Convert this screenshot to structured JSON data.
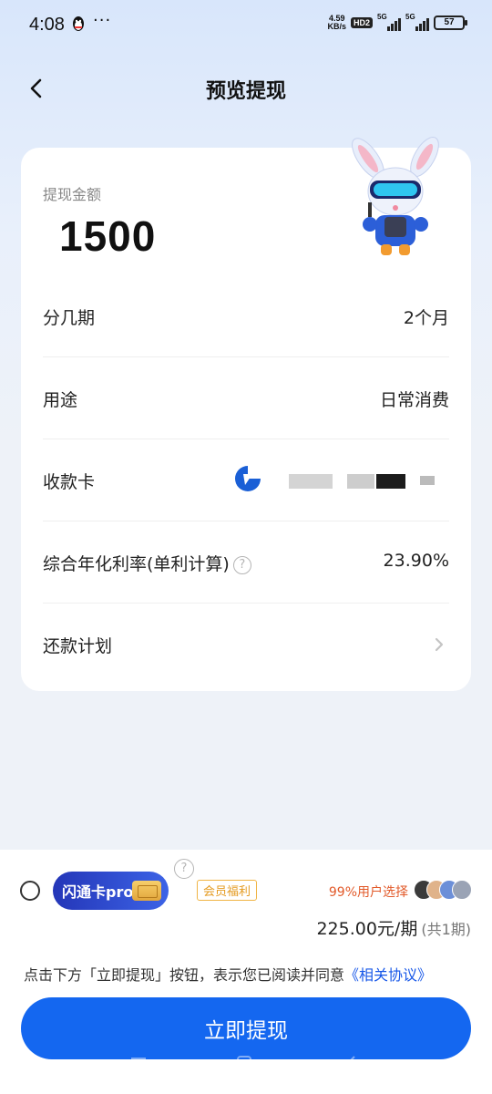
{
  "status_bar": {
    "time": "4:08",
    "dots": "···",
    "net_speed_value": "4.59",
    "net_speed_unit": "KB/s",
    "hd_badge": "HD2",
    "signal_1": "5G",
    "signal_2": "5G",
    "battery": "57"
  },
  "header": {
    "title": "预览提现",
    "back_icon": "chevron-left-icon"
  },
  "loan_card": {
    "amount_label": "提现金额",
    "amount": "1500",
    "rows": [
      {
        "label": "分几期",
        "value": "2个月"
      },
      {
        "label": "用途",
        "value": "日常消费"
      },
      {
        "label": "收款卡",
        "value": ""
      },
      {
        "label": "综合年化利率(单利计算)",
        "value": "23.90%"
      },
      {
        "label": "还款计划",
        "value": ""
      }
    ]
  },
  "membership": {
    "card_name": "闪通卡pro",
    "help_glyph": "?",
    "badge": "会员福利",
    "users_choice": "99%用户选择",
    "price": "225.00元/期",
    "total": "(共1期)"
  },
  "agreement": {
    "text": "点击下方「立即提现」按钮，表示您已阅读并同意",
    "link": "《相关协议》"
  },
  "submit_label": "立即提现",
  "colors": {
    "primary": "#1467f0",
    "accent_orange": "#e25a2a",
    "badge": "#e49a1f",
    "link": "#1757e8"
  }
}
